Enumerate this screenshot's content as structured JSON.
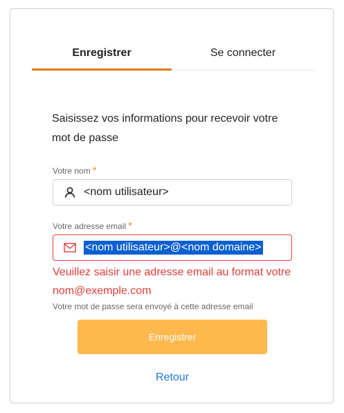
{
  "tabs": [
    {
      "label": "Enregistrer",
      "active": true
    },
    {
      "label": "Se connecter",
      "active": false
    }
  ],
  "intro": "Saisissez vos informations pour recevoir votre mot de passe",
  "name_field": {
    "label": "Votre nom",
    "required_mark": "*",
    "value": "<nom utilisateur>",
    "icon": "user-icon"
  },
  "email_field": {
    "label": "Votre adresse email",
    "required_mark": "*",
    "value": "<nom utilisateur>@<nom domaine>",
    "icon": "mail-icon",
    "error": "Veuillez saisir une adresse email au format votre nom@exemple.com",
    "hint": "Votre mot de passe sera envoyé à cette adresse email"
  },
  "submit_label": "Enregistrer",
  "back_label": "Retour",
  "colors": {
    "accent": "#e87611",
    "button": "#ffb84d",
    "error": "#e23b3b",
    "link": "#1a7ad4",
    "selection": "#0a5fd1"
  }
}
